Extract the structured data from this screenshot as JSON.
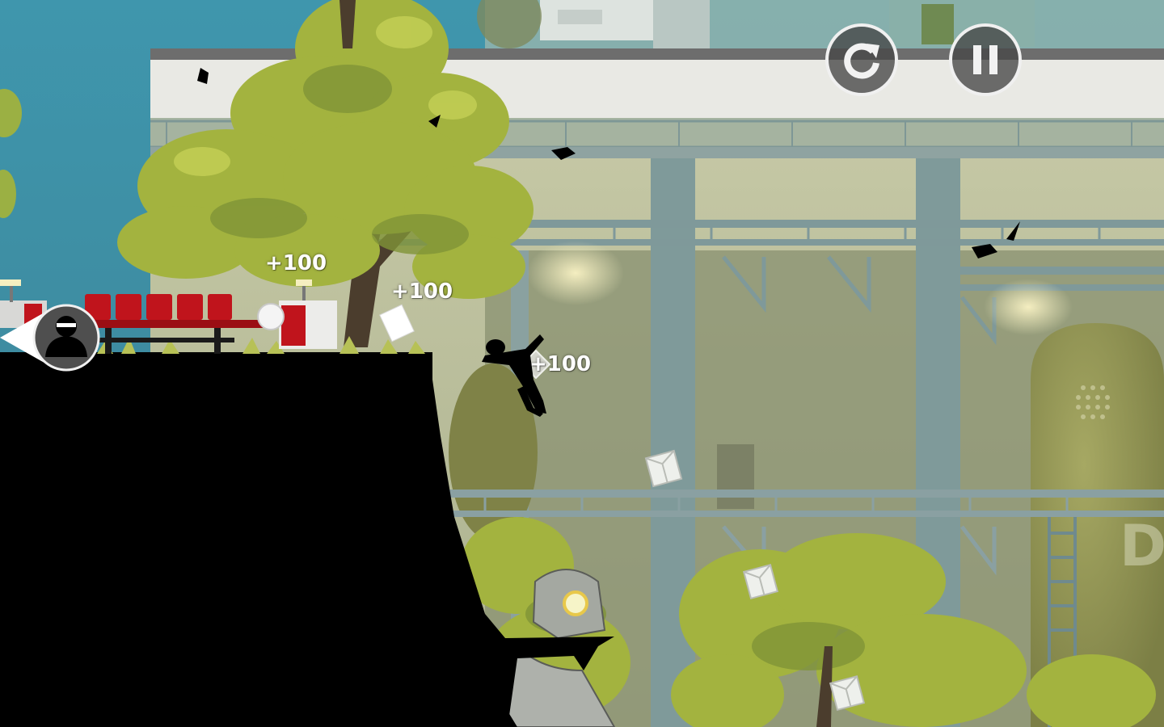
{
  "game": {
    "score_popups": [
      "+100",
      "+100",
      "+100"
    ]
  },
  "hud": {
    "restart_icon": "restart-icon",
    "pause_icon": "pause-icon",
    "hunter_icon": "hunter-indicator-icon"
  },
  "scene": {
    "wall_marking": "D"
  },
  "colors": {
    "sky": "#3f8fa3",
    "building": "#c7c9a4",
    "foliage": "#a8b840",
    "silhouette": "#000000",
    "seat_red": "#c0141c",
    "hud_bg": "#464646",
    "hud_border": "#f0f0f0"
  }
}
